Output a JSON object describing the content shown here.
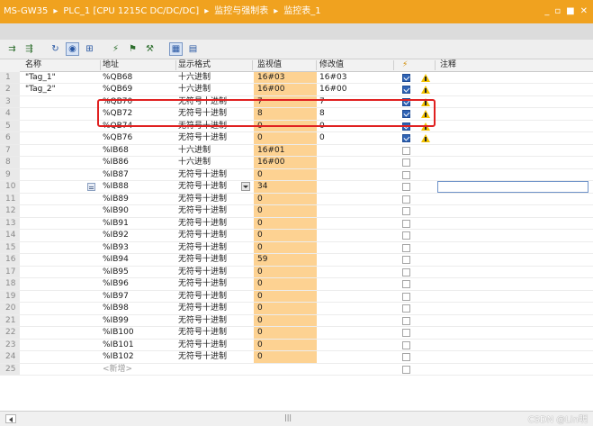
{
  "titlebar": {
    "crumbs": [
      "MS-GW35",
      "PLC_1 [CPU 1215C DC/DC/DC]",
      "监控与强制表",
      "监控表_1"
    ],
    "separator": "▸"
  },
  "window_controls": [
    "_",
    "▫",
    "■",
    "✕"
  ],
  "toolbar": {
    "icons": [
      "insert-row-icon",
      "add-row-icon",
      "monitor-once-icon",
      "monitor-all-icon",
      "show-hide-icon",
      "modify-icon",
      "modify-now-icon",
      "force-icon",
      "show-modify-columns-icon",
      "show-extended-icon"
    ]
  },
  "columns": {
    "name": "名称",
    "address": "地址",
    "format": "显示格式",
    "monitor": "监视值",
    "modify": "修改值",
    "modify_icon": "⚡",
    "comment": "注释"
  },
  "rows": [
    {
      "n": "1",
      "name": "\"Tag_1\"",
      "addr": "%QB68",
      "fmt": "十六进制",
      "mon": "16#03",
      "mod": "16#03",
      "chk": true,
      "warn": true
    },
    {
      "n": "2",
      "name": "\"Tag_2\"",
      "addr": "%QB69",
      "fmt": "十六进制",
      "mon": "16#00",
      "mod": "16#00",
      "chk": true,
      "warn": true
    },
    {
      "n": "3",
      "name": "",
      "addr": "%QB70",
      "fmt": "无符号十进制",
      "mon": "7",
      "mod": "7",
      "chk": true,
      "warn": true
    },
    {
      "n": "4",
      "name": "",
      "addr": "%QB72",
      "fmt": "无符号十进制",
      "mon": "8",
      "mod": "8",
      "chk": true,
      "warn": true
    },
    {
      "n": "5",
      "name": "",
      "addr": "%QB74",
      "fmt": "无符号十进制",
      "mon": "0",
      "mod": "0",
      "chk": true,
      "warn": true
    },
    {
      "n": "6",
      "name": "",
      "addr": "%QB76",
      "fmt": "无符号十进制",
      "mon": "0",
      "mod": "0",
      "chk": true,
      "warn": true
    },
    {
      "n": "7",
      "name": "",
      "addr": "%IB68",
      "fmt": "十六进制",
      "mon": "16#01",
      "mod": "",
      "chk": false,
      "warn": false
    },
    {
      "n": "8",
      "name": "",
      "addr": "%IB86",
      "fmt": "十六进制",
      "mon": "16#00",
      "mod": "",
      "chk": false,
      "warn": false
    },
    {
      "n": "9",
      "name": "",
      "addr": "%IB87",
      "fmt": "无符号十进制",
      "mon": "0",
      "mod": "",
      "chk": false,
      "warn": false
    },
    {
      "n": "10",
      "name": "",
      "addr": "%IB88",
      "fmt": "无符号十进制",
      "mon": "34",
      "mod": "",
      "chk": false,
      "warn": false,
      "selected": true
    },
    {
      "n": "11",
      "name": "",
      "addr": "%IB89",
      "fmt": "无符号十进制",
      "mon": "0",
      "mod": "",
      "chk": false,
      "warn": false
    },
    {
      "n": "12",
      "name": "",
      "addr": "%IB90",
      "fmt": "无符号十进制",
      "mon": "0",
      "mod": "",
      "chk": false,
      "warn": false
    },
    {
      "n": "13",
      "name": "",
      "addr": "%IB91",
      "fmt": "无符号十进制",
      "mon": "0",
      "mod": "",
      "chk": false,
      "warn": false
    },
    {
      "n": "14",
      "name": "",
      "addr": "%IB92",
      "fmt": "无符号十进制",
      "mon": "0",
      "mod": "",
      "chk": false,
      "warn": false
    },
    {
      "n": "15",
      "name": "",
      "addr": "%IB93",
      "fmt": "无符号十进制",
      "mon": "0",
      "mod": "",
      "chk": false,
      "warn": false
    },
    {
      "n": "16",
      "name": "",
      "addr": "%IB94",
      "fmt": "无符号十进制",
      "mon": "59",
      "mod": "",
      "chk": false,
      "warn": false
    },
    {
      "n": "17",
      "name": "",
      "addr": "%IB95",
      "fmt": "无符号十进制",
      "mon": "0",
      "mod": "",
      "chk": false,
      "warn": false
    },
    {
      "n": "18",
      "name": "",
      "addr": "%IB96",
      "fmt": "无符号十进制",
      "mon": "0",
      "mod": "",
      "chk": false,
      "warn": false
    },
    {
      "n": "19",
      "name": "",
      "addr": "%IB97",
      "fmt": "无符号十进制",
      "mon": "0",
      "mod": "",
      "chk": false,
      "warn": false
    },
    {
      "n": "20",
      "name": "",
      "addr": "%IB98",
      "fmt": "无符号十进制",
      "mon": "0",
      "mod": "",
      "chk": false,
      "warn": false
    },
    {
      "n": "21",
      "name": "",
      "addr": "%IB99",
      "fmt": "无符号十进制",
      "mon": "0",
      "mod": "",
      "chk": false,
      "warn": false
    },
    {
      "n": "22",
      "name": "",
      "addr": "%IB100",
      "fmt": "无符号十进制",
      "mon": "0",
      "mod": "",
      "chk": false,
      "warn": false
    },
    {
      "n": "23",
      "name": "",
      "addr": "%IB101",
      "fmt": "无符号十进制",
      "mon": "0",
      "mod": "",
      "chk": false,
      "warn": false
    },
    {
      "n": "24",
      "name": "",
      "addr": "%IB102",
      "fmt": "无符号十进制",
      "mon": "0",
      "mod": "",
      "chk": false,
      "warn": false
    },
    {
      "n": "25",
      "name": "",
      "addr": "<新增>",
      "fmt": "",
      "mon": "",
      "mod": "",
      "chk": false,
      "warn": false,
      "new": true
    }
  ],
  "scrollbar": {
    "thumb_mark": "|||"
  },
  "watermark": "CSDN @Lin明",
  "colors": {
    "titlebar": "#f0a21f",
    "monitor_bg": "#fdd292",
    "highlight": "#e02020",
    "checkbox": "#2f63b5"
  }
}
